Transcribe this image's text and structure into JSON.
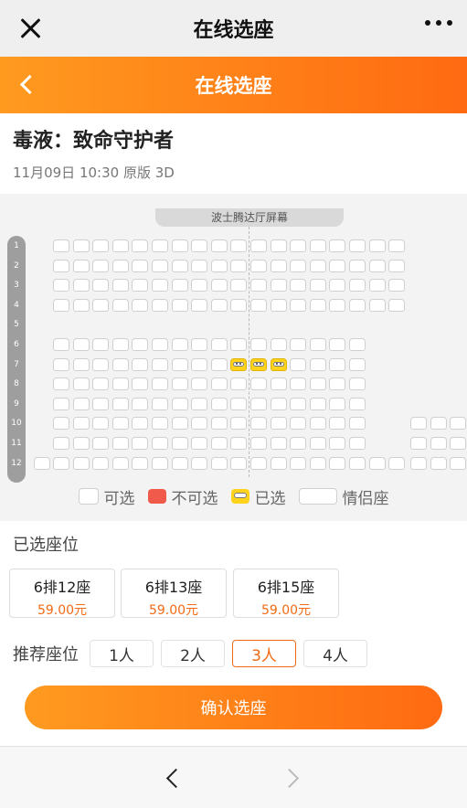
{
  "wechat_bar": {
    "title": "在线选座"
  },
  "header": {
    "title": "在线选座"
  },
  "movie": {
    "title": "毒液：致命守护者",
    "meta": "11月09日 10:30 原版 3D"
  },
  "seat_map": {
    "screen_label": "波士腾达厅屏幕",
    "rows": [
      "1",
      "2",
      "3",
      "4",
      "5",
      "6",
      "7",
      "8",
      "9",
      "10",
      "11",
      "12"
    ]
  },
  "legend": {
    "available": "可选",
    "unavailable": "不可选",
    "selected": "已选",
    "couple": "情侣座"
  },
  "selected_section": {
    "label": "已选座位",
    "tickets": [
      {
        "seat": "6排12座",
        "price": "59.00元"
      },
      {
        "seat": "6排13座",
        "price": "59.00元"
      },
      {
        "seat": "6排15座",
        "price": "59.00元"
      }
    ]
  },
  "recommend": {
    "label": "推荐座位",
    "options": [
      "1人",
      "2人",
      "3人",
      "4人"
    ],
    "active": "3人"
  },
  "confirm": {
    "label": "确认选座"
  },
  "colors": {
    "accent": "#ff6a12",
    "price": "#f26a16",
    "unavailable": "#f05a4a",
    "selected": "#ffd21c"
  }
}
